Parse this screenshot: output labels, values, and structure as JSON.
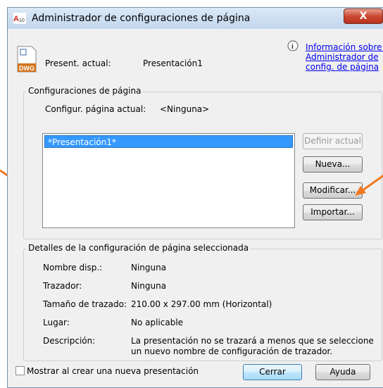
{
  "window": {
    "title": "Administrador de configuraciones de página",
    "close_label": "X",
    "app_icon_text": "A10"
  },
  "current": {
    "label": "Present. actual:",
    "value": "Presentación1",
    "icon_text": "DWG"
  },
  "info_link": {
    "line1": "Información sobre el",
    "line2": "Administrador de",
    "line3": "config. de página"
  },
  "configs_group": {
    "legend": "Configuraciones de página",
    "current_label": "Configur. página actual:",
    "current_value": "<Ninguna>",
    "list_items": [
      "*Presentación1*"
    ],
    "buttons": {
      "set_current": "Definir actual",
      "new": "Nueva...",
      "modify": "Modificar...",
      "import": "Importar..."
    }
  },
  "details_group": {
    "legend": "Detalles de la configuración de página seleccionada",
    "rows": [
      {
        "label": "Nombre disp.:",
        "value": "Ninguna"
      },
      {
        "label": "Trazador:",
        "value": "Ninguna"
      },
      {
        "label": "Tamaño de trazado:",
        "value": "210.00 x 297.00 mm (Horizontal)"
      },
      {
        "label": "Lugar:",
        "value": "No aplicable"
      },
      {
        "label": "Descripción:",
        "value_line1": "La presentación no se trazará a menos que se seleccione",
        "value_line2": "un nuevo nombre de configuración de trazador."
      }
    ]
  },
  "footer": {
    "checkbox_label": "Mostrar al crear una nueva presentación",
    "close_button": "Cerrar",
    "help_button": "Ayuda"
  },
  "colors": {
    "accent": "#3399ff",
    "arrow": "#f07820",
    "close_button": "#c94a33"
  }
}
